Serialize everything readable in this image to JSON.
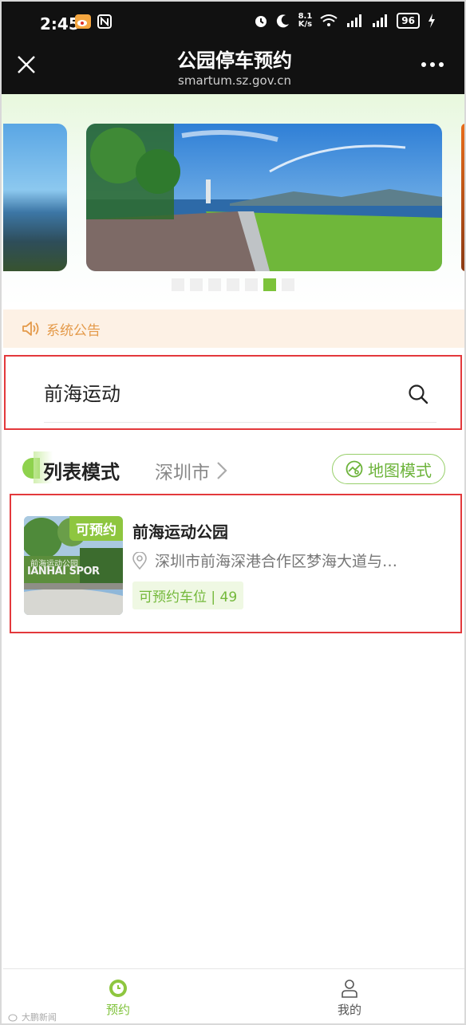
{
  "status_bar": {
    "time": "2:45",
    "speed": "8.1\nK/s",
    "battery": "96"
  },
  "header": {
    "title": "公园停车预约",
    "subtitle": "smartum.sz.gov.cn"
  },
  "banner": {
    "dots": 7,
    "active_dot": 5
  },
  "notice": {
    "label": "系统公告"
  },
  "search": {
    "value": "前海运动",
    "placeholder": ""
  },
  "mode": {
    "list_label": "列表模式",
    "city": "深圳市",
    "map_label": "地图模式"
  },
  "results": [
    {
      "badge": "可预约",
      "name": "前海运动公园",
      "address": "深圳市前海深港合作区梦海大道与…",
      "spots": "可预约车位 | 49",
      "thumb_text_cn": "前海运动公园",
      "thumb_text_en": "IANHAI SPOR"
    }
  ],
  "bottom_nav": {
    "book_label": "预约",
    "mine_label": "我的"
  },
  "watermark": "大鹏新闻",
  "colors": {
    "accent": "#7fc23a",
    "notice_text": "#e49a4a",
    "highlight_border": "#e3393c"
  }
}
